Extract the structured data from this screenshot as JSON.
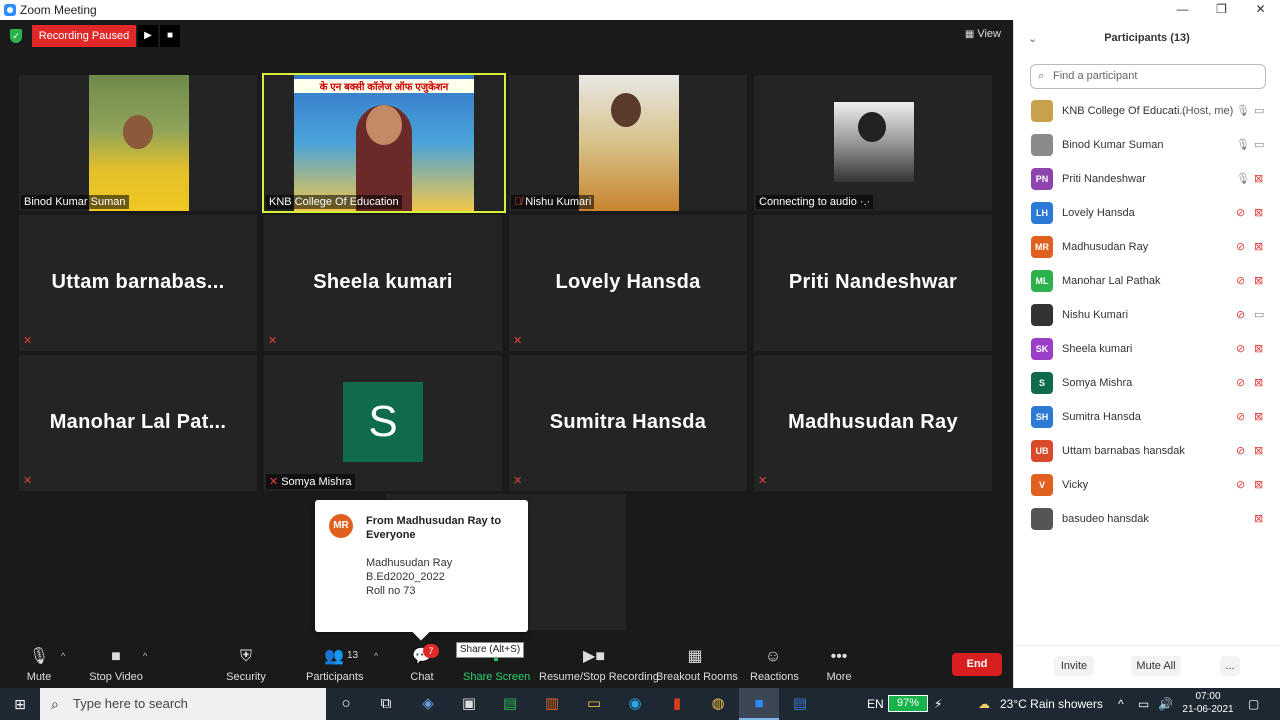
{
  "window": {
    "title": "Zoom Meeting",
    "controls": [
      "—",
      "❐",
      "✕"
    ]
  },
  "recording": {
    "status": "Recording Paused"
  },
  "view_button": {
    "label": "View"
  },
  "tiles": {
    "t1": {
      "name": "Binod Kumar Suman"
    },
    "t2": {
      "name": "KNB College Of Education",
      "banner": "के एन बक्सी कॉलेज ऑफ एजुकेशन"
    },
    "t3": {
      "name": "Nishu Kumari"
    },
    "t4": {
      "name": "Connecting to audio ·.·"
    },
    "t5": {
      "display": "Uttam  barnabas..."
    },
    "t6": {
      "display": "Sheela kumari"
    },
    "t7": {
      "display": "Lovely Hansda"
    },
    "t8": {
      "display": "Priti Nandeshwar"
    },
    "t9": {
      "display": "Manohar  Lal  Pat..."
    },
    "t10": {
      "name": "Somya Mishra",
      "initial": "S"
    },
    "t11": {
      "display": "Sumitra Hansda"
    },
    "t12": {
      "display": "Madhusudan Ray"
    }
  },
  "chat_popup": {
    "initials": "MR",
    "from": "From Madhusudan Ray to Everyone",
    "lines": [
      "Madhusudan Ray",
      "B.Ed2020_2022",
      "Roll no 73"
    ]
  },
  "toolbar": {
    "mute": "Mute",
    "stop_video": "Stop Video",
    "security": "Security",
    "participants": "Participants",
    "participant_count": "13",
    "chat": "Chat",
    "chat_badge": "7",
    "share_screen": "Share Screen",
    "share_tooltip": "Share (Alt+S)",
    "recording": "Resume/Stop Recording",
    "breakout": "Breakout Rooms",
    "reactions": "Reactions",
    "more": "More",
    "end": "End"
  },
  "panel": {
    "title": "Participants (13)",
    "search_placeholder": "Find a participant",
    "participants": [
      {
        "name": "KNB College Of Educati...",
        "tag": "(Host, me)",
        "initials": "",
        "color": "#c8a24a",
        "mic_off": false,
        "cam_off": false
      },
      {
        "name": "Binod Kumar Suman",
        "tag": "",
        "initials": "",
        "color": "#8a8a8a",
        "mic_off": false,
        "cam_off": false
      },
      {
        "name": "Priti Nandeshwar",
        "tag": "",
        "initials": "PN",
        "color": "#8e44ad",
        "mic_off": false,
        "cam_off": true
      },
      {
        "name": "Lovely Hansda",
        "tag": "",
        "initials": "LH",
        "color": "#2d7ad6",
        "mic_off": true,
        "cam_off": true
      },
      {
        "name": "Madhusudan Ray",
        "tag": "",
        "initials": "MR",
        "color": "#e0611f",
        "mic_off": true,
        "cam_off": true
      },
      {
        "name": "Manohar Lal Pathak",
        "tag": "",
        "initials": "ML",
        "color": "#2bb24c",
        "mic_off": true,
        "cam_off": true
      },
      {
        "name": "Nishu Kumari",
        "tag": "",
        "initials": "",
        "color": "#333333",
        "mic_off": true,
        "cam_off": false
      },
      {
        "name": "Sheela kumari",
        "tag": "",
        "initials": "SK",
        "color": "#9b3fc9",
        "mic_off": true,
        "cam_off": true
      },
      {
        "name": "Somya Mishra",
        "tag": "",
        "initials": "S",
        "color": "#0f6b4b",
        "mic_off": true,
        "cam_off": true
      },
      {
        "name": "Sumitra Hansda",
        "tag": "",
        "initials": "SH",
        "color": "#2d7ad6",
        "mic_off": true,
        "cam_off": true
      },
      {
        "name": "Uttam barnabas hansdak",
        "tag": "",
        "initials": "UB",
        "color": "#d94a2a",
        "mic_off": true,
        "cam_off": true
      },
      {
        "name": "Vicky",
        "tag": "",
        "initials": "V",
        "color": "#e0611f",
        "mic_off": true,
        "cam_off": true
      },
      {
        "name": "basudeo hansdak",
        "tag": "",
        "initials": "",
        "color": "#555555",
        "mic_off": null,
        "cam_off": true
      }
    ],
    "invite": "Invite",
    "mute_all": "Mute All",
    "more": "..."
  },
  "taskbar": {
    "search_placeholder": "Type here to search",
    "language": "EN",
    "battery": "97%",
    "weather": "23°C  Rain showers",
    "time": "07:00",
    "date": "21-06-2021"
  }
}
